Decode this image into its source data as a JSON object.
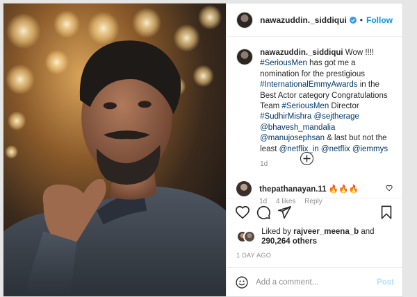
{
  "header": {
    "username": "nawazuddin._siddiqui",
    "separator": "•",
    "follow_label": "Follow",
    "verified_icon": "verified-badge-icon"
  },
  "caption": {
    "username": "nawazuddin._siddiqui",
    "segments": [
      {
        "text": " Wow !!!! ",
        "tag": false
      },
      {
        "text": "#SeriousMen",
        "tag": true
      },
      {
        "text": " has got me a nomination for the prestigious ",
        "tag": false
      },
      {
        "text": "#InternationalEmmyAwards",
        "tag": true
      },
      {
        "text": " in the Best Actor category Congratulations Team ",
        "tag": false
      },
      {
        "text": "#SeriousMen",
        "tag": true
      },
      {
        "text": " Director ",
        "tag": false
      },
      {
        "text": "#SudhirMishra",
        "tag": true
      },
      {
        "text": " ",
        "tag": false
      },
      {
        "text": "@sejtherage",
        "tag": true
      },
      {
        "text": " ",
        "tag": false
      },
      {
        "text": "@bhavesh_mandalia",
        "tag": true
      },
      {
        "text": " ",
        "tag": false
      },
      {
        "text": "@manujosephsan",
        "tag": true
      },
      {
        "text": " & last but not the least ",
        "tag": false
      },
      {
        "text": "@netflix_in",
        "tag": true
      },
      {
        "text": " ",
        "tag": false
      },
      {
        "text": "@netflix",
        "tag": true
      },
      {
        "text": " ",
        "tag": false
      },
      {
        "text": "@iemmys",
        "tag": true
      }
    ],
    "time": "1d"
  },
  "load_more_icon": "plus-circle-icon",
  "reply": {
    "username": "thepathanayan.11",
    "text": "🔥🔥🔥",
    "time": "1d",
    "likes": "4 likes",
    "reply_label": "Reply"
  },
  "likes": {
    "prefix": "Liked by ",
    "user": "rajveer_meena_b",
    "middle": " and",
    "count": "290,264 others"
  },
  "date": "1 DAY AGO",
  "add_comment": {
    "placeholder": "Add a comment...",
    "post_label": "Post"
  },
  "colors": {
    "accent": "#0095f6",
    "tag": "#00376b",
    "post_disabled": "#b2dffc",
    "muted": "#8e8e8e"
  }
}
